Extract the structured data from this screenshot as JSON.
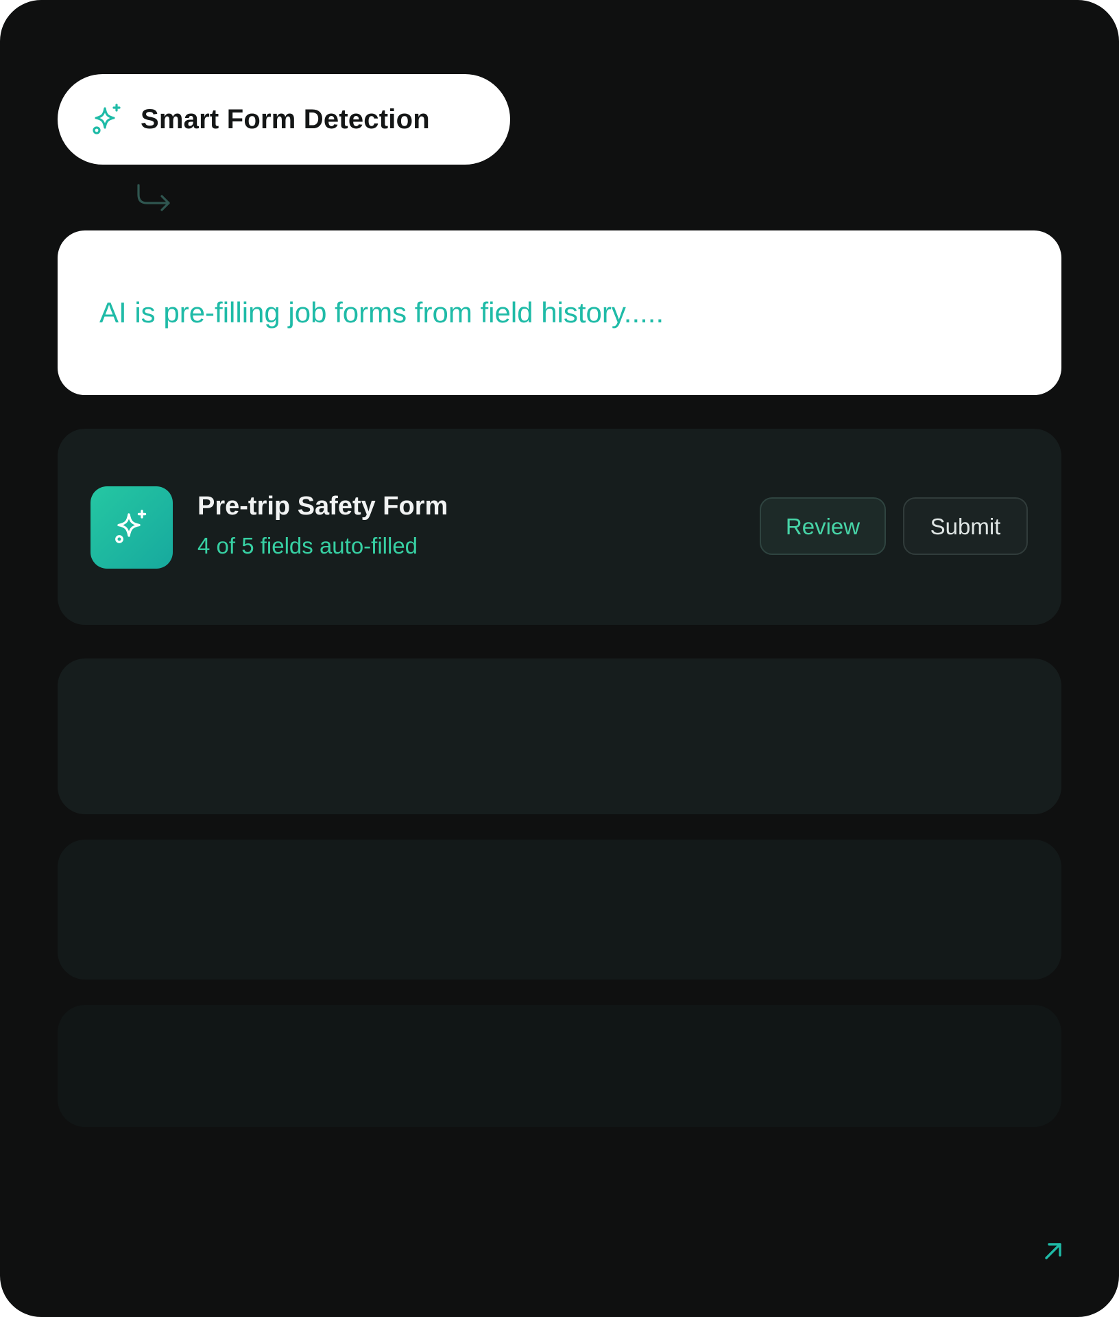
{
  "header": {
    "pill_label": "Smart Form Detection",
    "pill_icon": "sparkle-icon"
  },
  "status": {
    "message": "AI is pre-filling job forms from field history....."
  },
  "form_card": {
    "title": "Pre-trip Safety Form",
    "subtitle": "4 of 5 fields auto-filled",
    "fields_filled": 4,
    "fields_total": 5,
    "icon": "sparkle-icon",
    "review_label": "Review",
    "submit_label": "Submit"
  },
  "colors": {
    "background": "#0f1010",
    "accent": "#1fbba7",
    "accent_light": "#37d0a3",
    "card": "#161d1d"
  },
  "footer": {
    "icon": "arrow-up-right-icon"
  }
}
